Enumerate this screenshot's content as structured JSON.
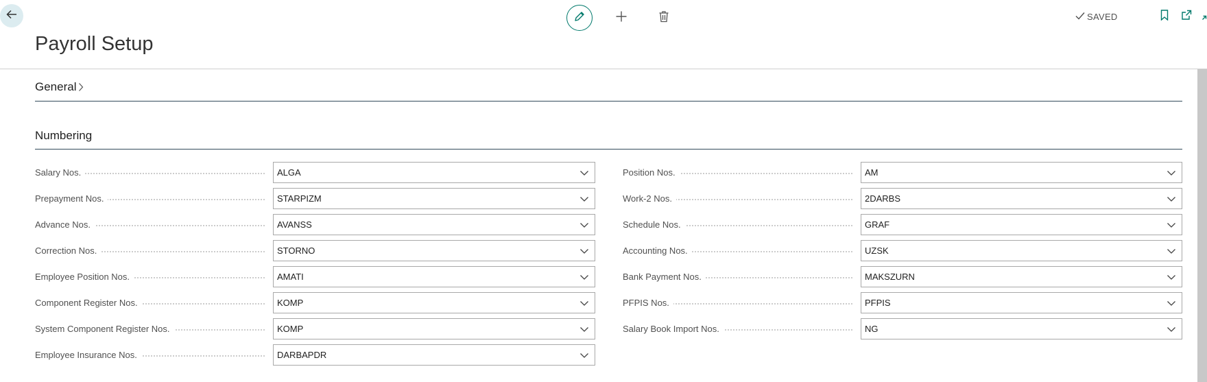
{
  "header": {
    "page_title": "Payroll Setup",
    "saved_label": "SAVED"
  },
  "icons": {
    "back": "back-arrow-icon",
    "edit": "pencil-icon",
    "add": "plus-icon",
    "delete": "trash-icon",
    "saved": "checkmark-icon",
    "bookmark": "bookmark-icon",
    "open_new_window": "open-in-new-window-icon",
    "collapse": "collapse-icon",
    "dropdown": "chevron-down-icon",
    "expand": "chevron-right-icon"
  },
  "colors": {
    "accent": "#00796b",
    "section_rule": "#324a5a",
    "back_button_bg": "#dcecf0"
  },
  "sections": {
    "general": {
      "title": "General"
    },
    "numbering": {
      "title": "Numbering",
      "left_fields": [
        {
          "label": "Salary Nos.",
          "value": "ALGA"
        },
        {
          "label": "Prepayment Nos.",
          "value": "STARPIZM"
        },
        {
          "label": "Advance Nos.",
          "value": "AVANSS"
        },
        {
          "label": "Correction Nos.",
          "value": "STORNO"
        },
        {
          "label": "Employee Position Nos.",
          "value": "AMATI"
        },
        {
          "label": "Component Register Nos.",
          "value": "KOMP"
        },
        {
          "label": "System Component Register Nos.",
          "value": "KOMP"
        },
        {
          "label": "Employee Insurance Nos.",
          "value": "DARBAPDR"
        }
      ],
      "right_fields": [
        {
          "label": "Position Nos.",
          "value": "AM"
        },
        {
          "label": "Work-2 Nos.",
          "value": "2DARBS"
        },
        {
          "label": "Schedule Nos.",
          "value": "GRAF"
        },
        {
          "label": "Accounting Nos.",
          "value": "UZSK"
        },
        {
          "label": "Bank Payment Nos.",
          "value": "MAKSZURN"
        },
        {
          "label": "PFPIS Nos.",
          "value": "PFPIS"
        },
        {
          "label": "Salary Book Import Nos.",
          "value": "NG"
        }
      ]
    }
  }
}
